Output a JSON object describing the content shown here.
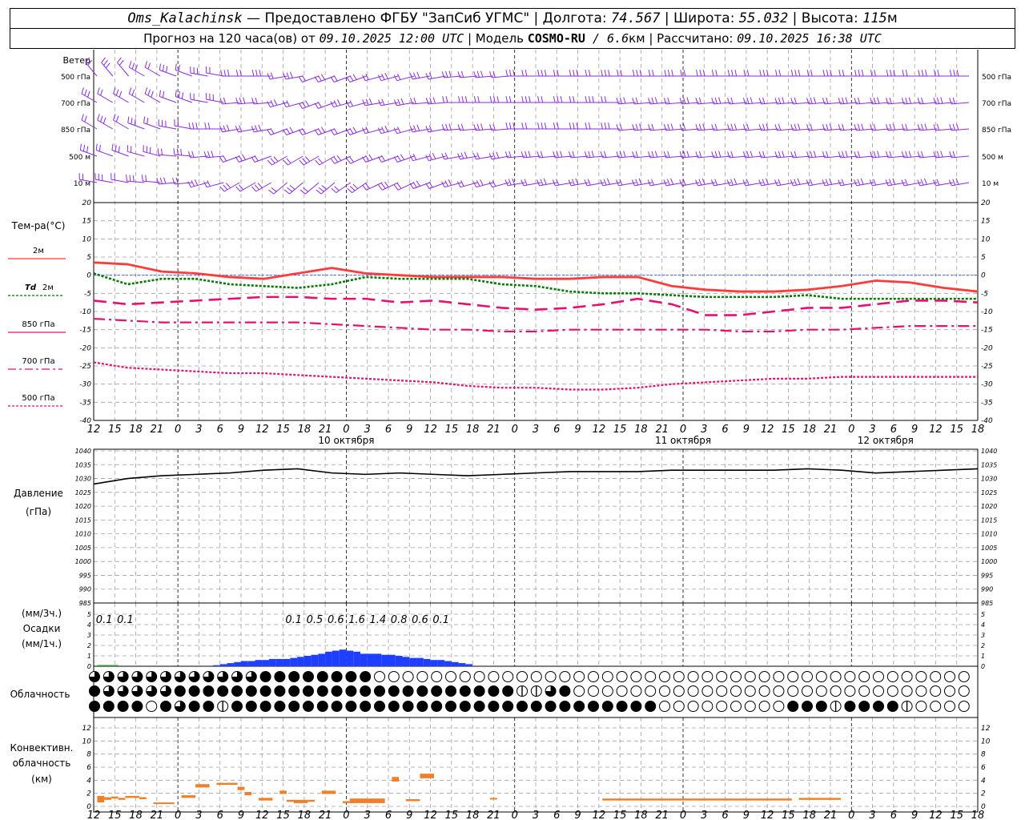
{
  "header": {
    "station": "Oms_Kalachinsk",
    "provider": " — Предоставлено ФГБУ \"ЗапСиб УГМС\" | ",
    "lon_label": "Долгота: ",
    "lon": "74.567",
    "lat_label": " | Широта: ",
    "lat": "55.032",
    "alt_label": " | Высота: ",
    "alt": "115",
    "alt_unit": "м",
    "forecast_label": "Прогноз на 120 часа(ов) от ",
    "forecast_start": "09.10.2025 12:00 UTC",
    "model_label": " | Модель ",
    "model": "COSMO-RU",
    "resolution": " / 6.6",
    "res_unit": "км",
    "calc_label": " | Рассчитано: ",
    "calc_time": "09.10.2025 16:38 UTC"
  },
  "labels": {
    "wind": "Ветер",
    "wind_levels": [
      "500 гПа",
      "700 гПа",
      "850 гПа",
      "500 м",
      "10 м"
    ],
    "temp_title": "Тем-ра(°C)",
    "temp_2m": "2м",
    "td_prefix": "Td",
    "td_suffix": "2м",
    "t850": "850 гПа",
    "t700": "700 гПа",
    "t500": "500 гПа",
    "pressure_title": "Давление",
    "pressure_unit": "(гПа)",
    "precip_3h": "(мм/3ч.)",
    "precip_title": "Осадки",
    "precip_1h": "(мм/1ч.)",
    "cloud_title": "Облачность",
    "conv_title_1": "Конвективн.",
    "conv_title_2": "облачность",
    "conv_unit": "(км)"
  },
  "colors": {
    "t2m": "#ff3b3b",
    "td2m": "#007a00",
    "t850": "#e8106e",
    "t700": "#e8106e",
    "t500": "#e8106e",
    "wind": "#8a2be2",
    "pressure": "#000000",
    "precip": "#1f3fff",
    "conv": "#f07f27"
  },
  "chart_data": {
    "type": "line",
    "x_hours": [
      0,
      3,
      6,
      9,
      12,
      15,
      18,
      21,
      24,
      27,
      30,
      33,
      36,
      39,
      42,
      45,
      48,
      51,
      54,
      57,
      60,
      63,
      66,
      69,
      72,
      75,
      78,
      81,
      84,
      87,
      90,
      93,
      96,
      99,
      102,
      105,
      108,
      111,
      114,
      117,
      120
    ],
    "x_tick_labels": [
      "12",
      "15",
      "18",
      "21",
      "0",
      "3",
      "6",
      "9",
      "12",
      "15",
      "18",
      "21",
      "0",
      "3",
      "6",
      "9",
      "12",
      "15",
      "18",
      "21",
      "0",
      "3",
      "6",
      "9",
      "12",
      "15",
      "18",
      "21",
      "0",
      "3",
      "6",
      "9",
      "12",
      "15",
      "18",
      "21",
      "0",
      "3",
      "6",
      "9",
      "12",
      "15",
      "18"
    ],
    "date_labels": [
      "10 октября",
      "11 октября",
      "12 октября"
    ],
    "temperature": {
      "ylim": [
        -40,
        20
      ],
      "yticks": [
        20,
        15,
        10,
        5,
        0,
        -5,
        -10,
        -15,
        -20,
        -25,
        -30,
        -35,
        -40
      ],
      "series": [
        {
          "name": "2м",
          "values": [
            3.5,
            3,
            1,
            0.5,
            -0.5,
            -1,
            0.5,
            2,
            0.5,
            0,
            -0.5,
            -0.5,
            -0.5,
            -1,
            -1,
            -0.5,
            -0.5,
            -3,
            -4,
            -4.5,
            -4.5,
            -4,
            -3,
            -1.5,
            -2,
            -3.5,
            -4.5
          ]
        },
        {
          "name": "Td 2м",
          "values": [
            0.5,
            -2.5,
            -1,
            -1,
            -2.5,
            -3,
            -3.5,
            -2.5,
            -0.5,
            -1,
            -1,
            -1,
            -2.5,
            -3,
            -4.5,
            -5,
            -5,
            -5.5,
            -6,
            -6,
            -6,
            -5.5,
            -6.5,
            -6.5,
            -6.5,
            -6.5,
            -6.5
          ]
        },
        {
          "name": "850 гПа",
          "values": [
            -7,
            -8,
            -7.5,
            -7,
            -6.5,
            -6,
            -6,
            -6.5,
            -6.5,
            -7.5,
            -7,
            -8,
            -9,
            -9.5,
            -9,
            -8,
            -6.5,
            -8,
            -11,
            -11,
            -10,
            -9,
            -9,
            -8,
            -7,
            -7,
            -7.5
          ]
        },
        {
          "name": "700 гПа",
          "values": [
            -12,
            -12.5,
            -13,
            -13,
            -13,
            -13,
            -13,
            -13.5,
            -14,
            -14.5,
            -15,
            -15,
            -15.5,
            -15.5,
            -15,
            -15,
            -15,
            -15,
            -15,
            -15.5,
            -15.5,
            -15,
            -15,
            -14.5,
            -14,
            -14,
            -14
          ]
        },
        {
          "name": "500 гПа",
          "values": [
            -24,
            -25.5,
            -26,
            -26.5,
            -27,
            -27,
            -27.5,
            -28,
            -28.5,
            -29,
            -29.5,
            -30.5,
            -31,
            -31,
            -31.5,
            -31.5,
            -31,
            -30,
            -29.5,
            -29,
            -28.5,
            -28.5,
            -28,
            -28,
            -28,
            -28,
            -28
          ]
        }
      ]
    },
    "pressure": {
      "ylim": [
        985,
        1040
      ],
      "yticks": [
        1040,
        1035,
        1030,
        1025,
        1020,
        1015,
        1010,
        1005,
        1000,
        995,
        990,
        985
      ],
      "values": [
        1028,
        1030,
        1031,
        1031.5,
        1032,
        1033,
        1033.5,
        1032,
        1031.5,
        1032,
        1031.5,
        1031,
        1031.5,
        1032,
        1032.5,
        1032.5,
        1032.5,
        1033,
        1033,
        1033,
        1033,
        1033.5,
        1033,
        1032,
        1032.5,
        1033,
        1033.5
      ]
    },
    "precipitation": {
      "ylim": [
        0,
        5
      ],
      "yticks": [
        5,
        4,
        3,
        2,
        1,
        0
      ],
      "totals_3h": [
        {
          "hour": 1.5,
          "label": "0.1"
        },
        {
          "hour": 4.5,
          "label": "0.1"
        },
        {
          "hour": 28.5,
          "label": "0.1"
        },
        {
          "hour": 31.5,
          "label": "0.5"
        },
        {
          "hour": 34.5,
          "label": "0.6"
        },
        {
          "hour": 37.5,
          "label": "1.6"
        },
        {
          "hour": 40.5,
          "label": "1.4"
        },
        {
          "hour": 43.5,
          "label": "0.8"
        },
        {
          "hour": 46.5,
          "label": "0.6"
        },
        {
          "hour": 49.5,
          "label": "0.1"
        }
      ],
      "hourly_start": 17,
      "hourly": [
        0.05,
        0.1,
        0.15,
        0.2,
        0.25,
        0.25,
        0.3,
        0.3,
        0.35,
        0.35,
        0.35,
        0.4,
        0.45,
        0.5,
        0.55,
        0.6,
        0.7,
        0.75,
        0.8,
        0.75,
        0.7,
        0.6,
        0.6,
        0.6,
        0.55,
        0.55,
        0.5,
        0.45,
        0.4,
        0.4,
        0.35,
        0.3,
        0.3,
        0.25,
        0.2,
        0.15,
        0.1
      ]
    },
    "cloud_layers": {
      "top": "2222222222222333333333000000000000000000000000000000000000000000000000",
      "mid": "3222223333333333333333333333333331312300000000000000000000000000000000",
      "low": "3333033233133033333333333333333333333333333333300000000004333143333100000"
    },
    "convective_cloud_km": {
      "ylim": [
        0,
        13
      ],
      "yticks": [
        12,
        10,
        8,
        6,
        4,
        2,
        0
      ],
      "segments": [
        {
          "h0": 0.5,
          "h1": 1.5,
          "bottom": 0.6,
          "top": 1.6
        },
        {
          "h0": 1.5,
          "h1": 2.5,
          "bottom": 1.0,
          "top": 1.4
        },
        {
          "h0": 2.5,
          "h1": 3.5,
          "bottom": 1.2,
          "top": 1.5
        },
        {
          "h0": 3.5,
          "h1": 4.5,
          "bottom": 1.0,
          "top": 1.3
        },
        {
          "h0": 4.5,
          "h1": 6.5,
          "bottom": 1.3,
          "top": 1.6
        },
        {
          "h0": 6.5,
          "h1": 7.5,
          "bottom": 1.1,
          "top": 1.4
        },
        {
          "h0": 8.5,
          "h1": 11.5,
          "bottom": 0.4,
          "top": 0.6
        },
        {
          "h0": 12.5,
          "h1": 14.5,
          "bottom": 1.3,
          "top": 1.7
        },
        {
          "h0": 14.5,
          "h1": 16.5,
          "bottom": 2.9,
          "top": 3.4
        },
        {
          "h0": 17.5,
          "h1": 20.5,
          "bottom": 3.3,
          "top": 3.6
        },
        {
          "h0": 20.5,
          "h1": 21.5,
          "bottom": 2.5,
          "top": 3.0
        },
        {
          "h0": 21.5,
          "h1": 22.5,
          "bottom": 1.7,
          "top": 2.2
        },
        {
          "h0": 23.5,
          "h1": 25.5,
          "bottom": 0.9,
          "top": 1.3
        },
        {
          "h0": 26.5,
          "h1": 27.5,
          "bottom": 1.9,
          "top": 2.4
        },
        {
          "h0": 27.5,
          "h1": 28.5,
          "bottom": 0.7,
          "top": 1.0
        },
        {
          "h0": 28.5,
          "h1": 30.5,
          "bottom": 0.5,
          "top": 1.0
        },
        {
          "h0": 30.5,
          "h1": 31.5,
          "bottom": 0.7,
          "top": 1.0
        },
        {
          "h0": 32.5,
          "h1": 34.5,
          "bottom": 1.9,
          "top": 2.4
        },
        {
          "h0": 35.5,
          "h1": 36.5,
          "bottom": 0.5,
          "top": 0.8
        },
        {
          "h0": 36.5,
          "h1": 41.5,
          "bottom": 0.5,
          "top": 1.2
        },
        {
          "h0": 42.5,
          "h1": 43.5,
          "bottom": 3.8,
          "top": 4.5
        },
        {
          "h0": 44.5,
          "h1": 46.5,
          "bottom": 0.8,
          "top": 1.1
        },
        {
          "h0": 46.5,
          "h1": 48.5,
          "bottom": 4.3,
          "top": 5.0
        },
        {
          "h0": 56.5,
          "h1": 57.5,
          "bottom": 1.1,
          "top": 1.3
        },
        {
          "h0": 72.5,
          "h1": 99.5,
          "bottom": 0.9,
          "top": 1.2
        },
        {
          "h0": 100.5,
          "h1": 106.5,
          "bottom": 1.0,
          "top": 1.3
        }
      ]
    }
  }
}
